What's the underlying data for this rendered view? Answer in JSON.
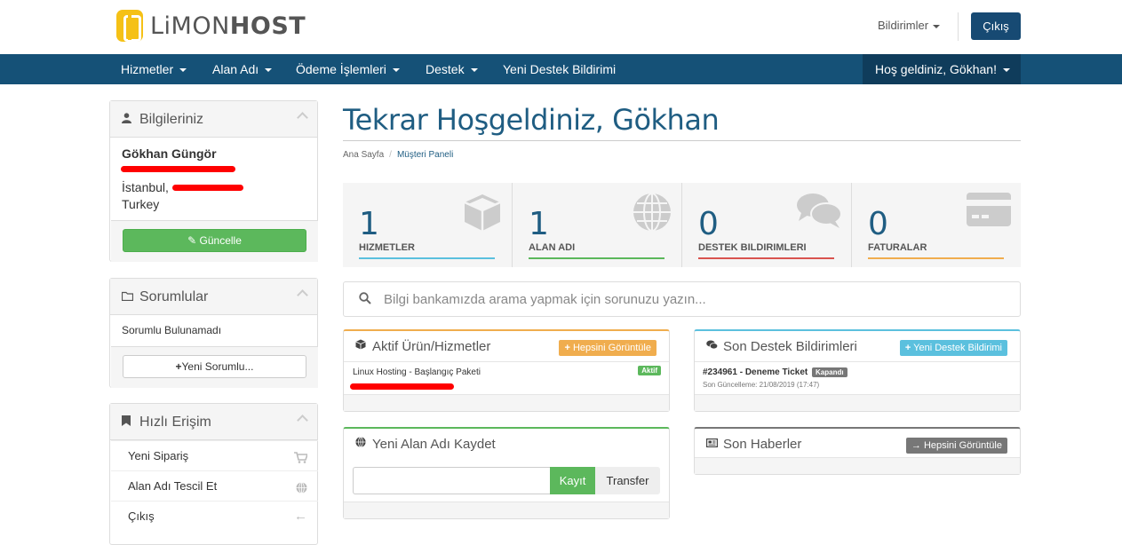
{
  "brand": {
    "name_light": "LiMON",
    "name_bold": "HOST",
    "accent": "#f5c116"
  },
  "topbar": {
    "notifications_label": "Bildirimler",
    "logout_label": "Çıkış"
  },
  "nav": {
    "items": [
      "Hizmetler",
      "Alan Adı",
      "Ödeme İşlemleri",
      "Destek",
      "Yeni Destek Bildirimi"
    ],
    "welcome": "Hoş geldiniz, Gökhan!"
  },
  "sidebar": {
    "info": {
      "title": "Bilgileriniz",
      "name": "Gökhan Güngör",
      "city": "İstanbul,",
      "country": "Turkey",
      "update_label": "Güncelle"
    },
    "contacts": {
      "title": "Sorumlular",
      "empty_text": "Sorumlu Bulunamadı",
      "new_label": "Yeni Sorumlu..."
    },
    "quick": {
      "title": "Hızlı Erişim",
      "items": [
        {
          "label": "Yeni Sipariş",
          "icon": "cart-icon"
        },
        {
          "label": "Alan Adı Tescil Et",
          "icon": "globe-icon"
        },
        {
          "label": "Çıkış",
          "icon": "arrow-left-icon"
        }
      ]
    }
  },
  "main": {
    "title": "Tekrar Hoşgeldiniz, Gökhan",
    "breadcrumb": [
      "Ana Sayfa",
      "Müşteri Paneli"
    ],
    "stats": [
      {
        "value": "1",
        "label": "HIZMETLER",
        "color": "#5bc0de",
        "icon": "cube-icon"
      },
      {
        "value": "1",
        "label": "ALAN ADI",
        "color": "#5cb85c",
        "icon": "globe-icon"
      },
      {
        "value": "0",
        "label": "DESTEK BILDIRIMLERI",
        "color": "#d9534f",
        "icon": "comments-icon"
      },
      {
        "value": "0",
        "label": "FATURALAR",
        "color": "#f0ad4e",
        "icon": "credit-card-icon"
      }
    ],
    "search_placeholder": "Bilgi bankamızda arama yapmak için sorunuzu yazın...",
    "active_services": {
      "title": "Aktif Ürün/Hizmetler",
      "view_all": "Hepsini Görüntüle",
      "item": "Linux Hosting - Başlangıç Paketi",
      "status": "Aktif"
    },
    "tickets": {
      "title": "Son Destek Bildirimleri",
      "new_label": "Yeni Destek Bildirimi",
      "ticket_title": "#234961 - Deneme Ticket",
      "ticket_status": "Kapandı",
      "ticket_updated": "Son Güncelleme: 21/08/2019 (17:47)"
    },
    "domain": {
      "title": "Yeni Alan Adı Kaydet",
      "register_label": "Kayıt",
      "transfer_label": "Transfer"
    },
    "news": {
      "title": "Son Haberler",
      "view_all": "Hepsini Görüntüle"
    }
  }
}
